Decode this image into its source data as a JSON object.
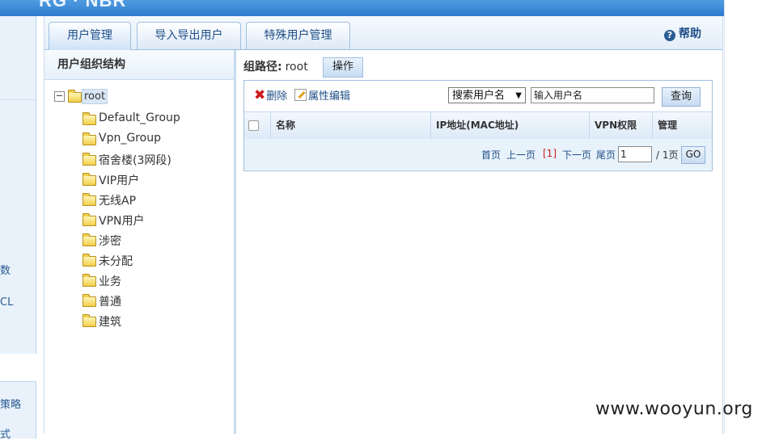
{
  "header": {
    "logo": "RG · NBR"
  },
  "leftnav": {
    "fragments": [
      "",
      "数",
      "CL",
      "策略",
      "式"
    ]
  },
  "tabs": [
    {
      "label": "用户管理",
      "active": true
    },
    {
      "label": "导入导出用户",
      "active": false
    },
    {
      "label": "特殊用户管理",
      "active": false
    }
  ],
  "help": {
    "label": "帮助"
  },
  "tree": {
    "title": "用户组织结构",
    "root": "root",
    "children": [
      "Default_Group",
      "Vpn_Group",
      "宿舍楼(3网段)",
      "VIP用户",
      "无线AP",
      "VPN用户",
      "涉密",
      "未分配",
      "业务",
      "普通",
      "建筑"
    ]
  },
  "path": {
    "label": "组路径:",
    "value": "root",
    "op_button": "操作"
  },
  "toolbar": {
    "delete_label": "删除",
    "edit_label": "属性编辑",
    "search_select": "搜索用户名",
    "search_input": "输入用户名",
    "query_button": "查询"
  },
  "table": {
    "columns": [
      "名称",
      "IP地址(MAC地址)",
      "VPN权限",
      "管理"
    ]
  },
  "pager": {
    "first": "首页",
    "prev": "上一页",
    "current": "[1]",
    "next": "下一页",
    "last": "尾页",
    "page_value": "1",
    "total": "/ 1页",
    "go": "GO"
  },
  "watermark": "www.wooyun.org"
}
